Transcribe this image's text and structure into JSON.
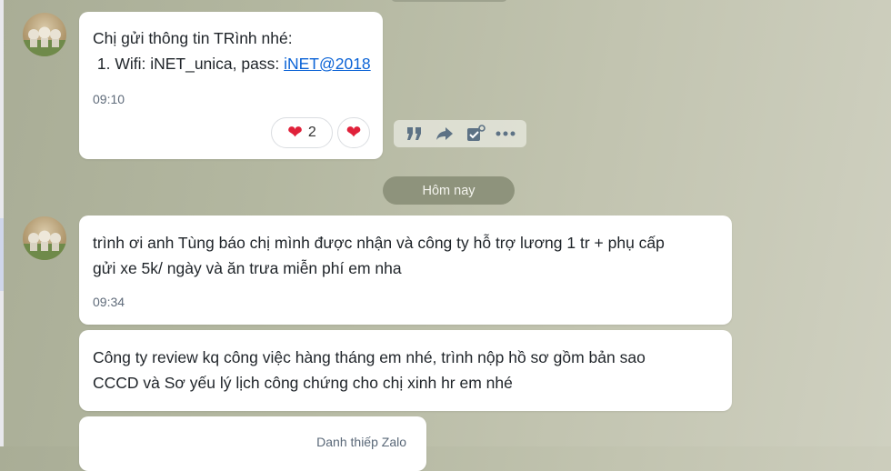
{
  "colors": {
    "link": "#0b63d6",
    "heart": "#e0213a",
    "date_pill": "#8e937c"
  },
  "messages": [
    {
      "lines": [
        "Chị gửi thông tin TRình nhé:",
        " 1. Wifi: iNET_unica, pass: "
      ],
      "link_text": "iNET@2018",
      "time": "09:10",
      "reactions": {
        "icon": "heart-icon",
        "count": "2"
      }
    },
    {
      "lines": [
        "trình ơi anh Tùng báo chị mình được nhận và công ty hỗ trợ lương 1 tr + phụ cấp",
        "gửi xe 5k/ ngày và ăn trưa miễn phí em nha"
      ],
      "time": "09:34"
    },
    {
      "lines": [
        "Công ty review kq công việc hàng tháng em nhé, trình nộp hồ sơ gồm bản sao",
        "CCCD và Sơ yếu lý lịch công chứng cho chị xinh hr em nhé"
      ]
    }
  ],
  "message_actions": [
    "quote-icon",
    "forward-icon",
    "task-icon",
    "more-icon"
  ],
  "date_separator": "Hôm nay",
  "card": {
    "label": "Danh thiếp Zalo"
  }
}
